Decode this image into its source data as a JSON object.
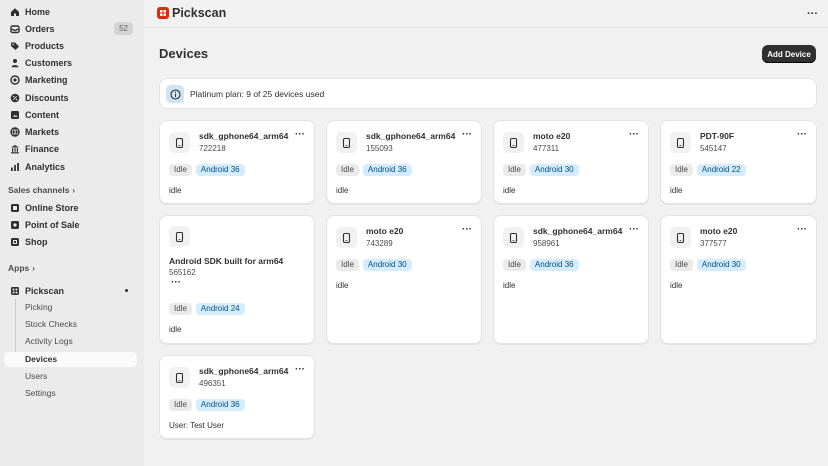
{
  "sidebar": {
    "items": [
      {
        "label": "Home",
        "icon": "home-icon"
      },
      {
        "label": "Orders",
        "icon": "orders-icon",
        "badge": "52"
      },
      {
        "label": "Products",
        "icon": "tag-icon"
      },
      {
        "label": "Customers",
        "icon": "person-icon"
      },
      {
        "label": "Marketing",
        "icon": "target-icon"
      },
      {
        "label": "Discounts",
        "icon": "discount-icon"
      },
      {
        "label": "Content",
        "icon": "content-icon"
      },
      {
        "label": "Markets",
        "icon": "globe-icon"
      },
      {
        "label": "Finance",
        "icon": "bank-icon"
      },
      {
        "label": "Analytics",
        "icon": "chart-icon"
      }
    ],
    "sales_channels_label": "Sales channels",
    "channels": [
      {
        "label": "Online Store",
        "icon": "store-icon"
      },
      {
        "label": "Point of Sale",
        "icon": "pos-icon"
      },
      {
        "label": "Shop",
        "icon": "shop-icon"
      }
    ],
    "apps_label": "Apps",
    "app": {
      "label": "Pickscan",
      "icon": "pickscan-app-icon"
    },
    "app_pages": [
      "Picking",
      "Stock Checks",
      "Activity Logs",
      "Devices",
      "Users",
      "Settings"
    ],
    "active_page": "Devices"
  },
  "appbar": {
    "title": "Pickscan",
    "menu": "···",
    "logo_color": "#d82c0d"
  },
  "page": {
    "title": "Devices",
    "add_button": "Add Device"
  },
  "banner": {
    "text": "Platinum plan: 9 of 25 devices used"
  },
  "devices": [
    {
      "name": "sdk_gphone64_arm64",
      "code": "722218",
      "status": "Idle",
      "os": "Android 36",
      "note": "idle"
    },
    {
      "name": "sdk_gphone64_arm64",
      "code": "155093",
      "status": "Idle",
      "os": "Android 36",
      "note": "idle"
    },
    {
      "name": "moto e20",
      "code": "477311",
      "status": "Idle",
      "os": "Android 30",
      "note": "idle"
    },
    {
      "name": "PDT-90F",
      "code": "545147",
      "status": "Idle",
      "os": "Android 22",
      "note": "idle"
    },
    {
      "name": "Android SDK built for arm64",
      "code": "565162",
      "status": "Idle",
      "os": "Android 24",
      "note": "idle"
    },
    {
      "name": "moto e20",
      "code": "743289",
      "status": "Idle",
      "os": "Android 30",
      "note": "idle"
    },
    {
      "name": "sdk_gphone64_arm64",
      "code": "958961",
      "status": "Idle",
      "os": "Android 36",
      "note": "idle"
    },
    {
      "name": "moto e20",
      "code": "377577",
      "status": "Idle",
      "os": "Android 30",
      "note": "idle"
    },
    {
      "name": "sdk_gphone64_arm64",
      "code": "496351",
      "status": "Idle",
      "os": "Android 36",
      "note": "User: Test User"
    }
  ],
  "card_menu": "···",
  "colors": {
    "accent": "#303030",
    "os_tag_bg": "#d5ebff",
    "os_tag_text": "#00527c",
    "info_bg": "#cfe3f5"
  }
}
